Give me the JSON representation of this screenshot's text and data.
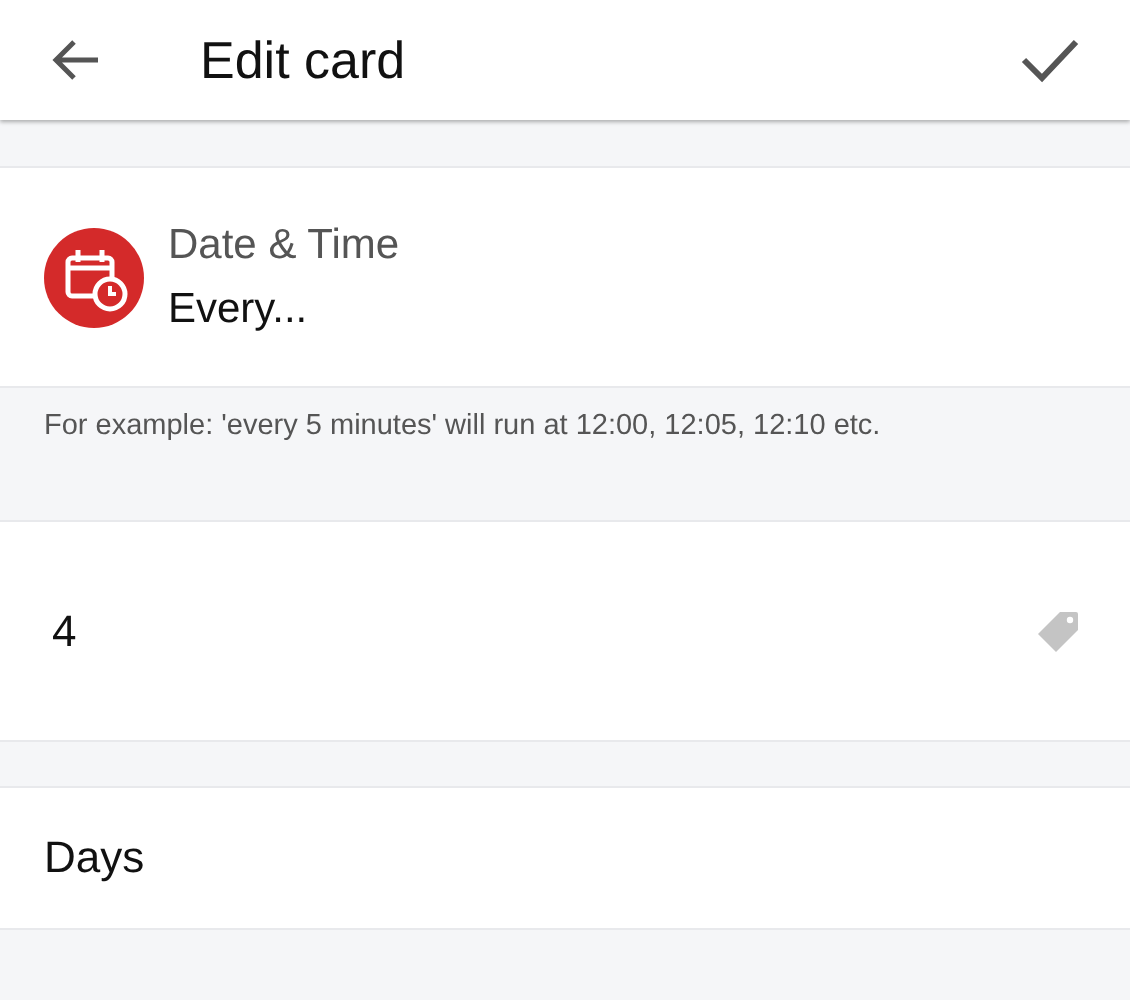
{
  "header": {
    "title": "Edit card"
  },
  "card": {
    "title": "Date & Time",
    "subtitle": "Every..."
  },
  "hint": "For example: 'every 5 minutes' will run at 12:00, 12:05, 12:10 etc.",
  "amount_field": {
    "value": "4"
  },
  "unit_field": {
    "value": "Days"
  }
}
